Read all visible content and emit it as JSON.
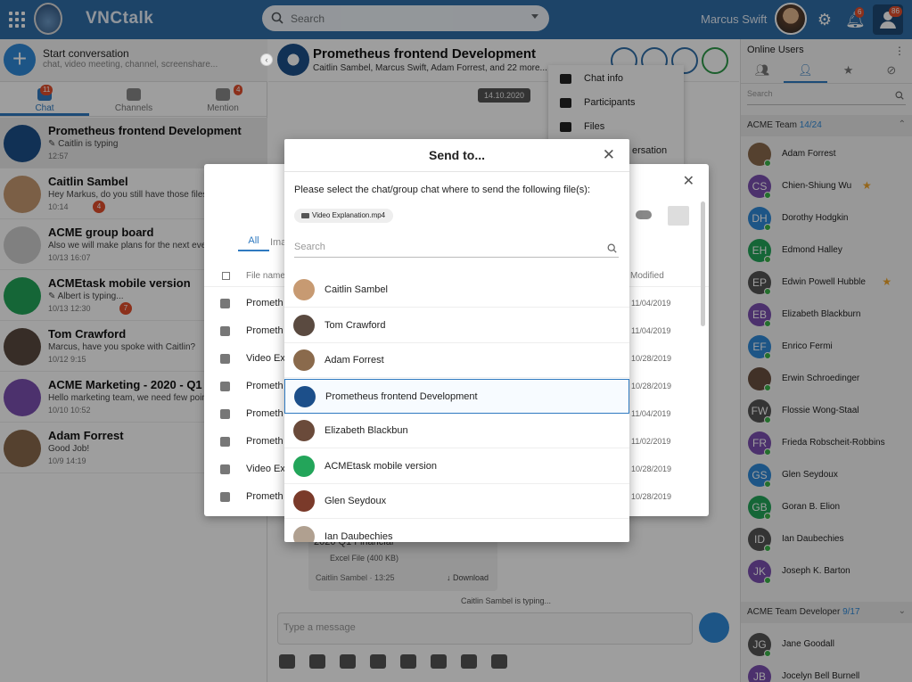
{
  "topbar": {
    "app_name": "VNCtalk",
    "search_placeholder": "Search",
    "user_name": "Marcus Swift",
    "notif_count": "6",
    "profile_count": "86"
  },
  "left": {
    "start_title": "Start conversation",
    "start_sub": "chat, video meeting, channel, screenshare...",
    "tabs": [
      {
        "label": "Chat",
        "badge": "11"
      },
      {
        "label": "Channels",
        "badge": ""
      },
      {
        "label": "Mention",
        "badge": "4"
      }
    ],
    "conversations": [
      {
        "name": "Prometheus frontend Development",
        "preview": "✎ Caitlin is typing",
        "time": "12:57",
        "count": "",
        "avatar": "#1c4f8a"
      },
      {
        "name": "Caitlin Sambel",
        "preview": "Hey Markus, do you still have those files",
        "time": "10:14",
        "count": "4",
        "avatar": "#c79a72"
      },
      {
        "name": "ACME group board",
        "preview": "Also we will make plans for the next ever",
        "time": "10/13 16:07",
        "count": "",
        "avatar": "#cfcfcf"
      },
      {
        "name": "ACMEtask mobile version",
        "preview": "✎ Albert is typing...",
        "time": "10/13 12:30",
        "count": "7",
        "avatar": "#23a55a"
      },
      {
        "name": "Tom Crawford",
        "preview": "Marcus, have you spoke with Caitlin?",
        "time": "10/12 9:15",
        "count": "",
        "avatar": "#5a4a40"
      },
      {
        "name": "ACME Marketing - 2020 - Q1 st",
        "preview": "Hello marketing team, we need few poin",
        "time": "10/10 10:52",
        "count": "",
        "avatar": "#7b4fb0"
      },
      {
        "name": "Adam Forrest",
        "preview": "Good Job!",
        "time": "10/9 14:19",
        "count": "",
        "avatar": "#8a6a4c"
      }
    ]
  },
  "chat": {
    "title": "Prometheus frontend Development",
    "members": "Caitlin Sambel, Marcus Swift, Adam Forrest, and 22 more...",
    "date": "14.10.2020",
    "menu": [
      "Chat info",
      "Participants",
      "Files",
      "ersation"
    ],
    "msg_title": "2020 Q1 Financial",
    "msg_file": "Excel File (400 KB)",
    "msg_meta": "Caitlin Sambel · 13:25",
    "msg_download": "↓ Download",
    "typing": "Caitlin Sambel is typing...",
    "composer_placeholder": "Type a message"
  },
  "right": {
    "title": "Online Users",
    "search_placeholder": "Search",
    "group1": {
      "name": "ACME Team",
      "count": "14/24"
    },
    "users1": [
      {
        "name": "Adam Forrest",
        "initials": "",
        "color": "#8a6a4c",
        "star": false
      },
      {
        "name": "Chien-Shiung Wu",
        "initials": "CS",
        "color": "#7b4fb0",
        "star": true
      },
      {
        "name": "Dorothy Hodgkin",
        "initials": "DH",
        "color": "#2f8ad8",
        "star": false
      },
      {
        "name": "Edmond Halley",
        "initials": "EH",
        "color": "#23a55a",
        "star": false
      },
      {
        "name": "Edwin Powell Hubble",
        "initials": "EP",
        "color": "#555555",
        "star": true
      },
      {
        "name": "Elizabeth Blackburn",
        "initials": "EB",
        "color": "#7b4fb0",
        "star": false
      },
      {
        "name": "Enrico Fermi",
        "initials": "EF",
        "color": "#2f8ad8",
        "star": false
      },
      {
        "name": "Erwin Schroedinger",
        "initials": "",
        "color": "#6a5040",
        "star": false
      },
      {
        "name": "Flossie Wong-Staal",
        "initials": "FW",
        "color": "#555555",
        "star": false
      },
      {
        "name": "Frieda Robscheit-Robbins",
        "initials": "FR",
        "color": "#7b4fb0",
        "star": false
      },
      {
        "name": "Glen Seydoux",
        "initials": "GS",
        "color": "#2f8ad8",
        "star": false
      },
      {
        "name": "Goran B. Elion",
        "initials": "GB",
        "color": "#23a55a",
        "star": false
      },
      {
        "name": "Ian Daubechies",
        "initials": "ID",
        "color": "#555555",
        "star": false
      },
      {
        "name": "Joseph K. Barton",
        "initials": "JK",
        "color": "#7b4fb0",
        "star": false
      }
    ],
    "group2": {
      "name": "ACME Team Developer",
      "count": "9/17"
    },
    "users2": [
      {
        "name": "Jane Goodall",
        "initials": "JG",
        "color": "#555555",
        "star": false
      },
      {
        "name": "Jocelyn Bell Burnell",
        "initials": "JB",
        "color": "#7b4fb0",
        "star": false
      }
    ]
  },
  "files_dialog": {
    "tab_all": "All",
    "tab_images": "Ima",
    "col_name": "File name",
    "col_modified": "Modified",
    "rows": [
      {
        "name": "Prometh",
        "date": "11/04/2019"
      },
      {
        "name": "Prometh",
        "date": "11/04/2019"
      },
      {
        "name": "Video Ex",
        "date": "10/28/2019"
      },
      {
        "name": "Prometh",
        "date": "10/28/2019"
      },
      {
        "name": "Prometh",
        "date": "11/04/2019"
      },
      {
        "name": "Prometh",
        "date": "11/02/2019"
      },
      {
        "name": "Video Ex",
        "date": "10/28/2019"
      },
      {
        "name": "Prometh",
        "date": "10/28/2019"
      }
    ]
  },
  "modal": {
    "title": "Send to...",
    "instruction": "Please select the chat/group chat where to send the following file(s):",
    "file_chip": "Video Explanation.mp4",
    "search_placeholder": "Search",
    "items": [
      {
        "name": "Caitlin Sambel",
        "color": "#c79a72",
        "selected": false
      },
      {
        "name": "Tom Crawford",
        "color": "#5a4a40",
        "selected": false
      },
      {
        "name": "Adam Forrest",
        "color": "#8a6a4c",
        "selected": false
      },
      {
        "name": "Prometheus frontend Development",
        "color": "#1c4f8a",
        "selected": true
      },
      {
        "name": "Elizabeth Blackbun",
        "color": "#6a4a3a",
        "selected": false
      },
      {
        "name": "ACMEtask mobile version",
        "color": "#23a55a",
        "selected": false
      },
      {
        "name": "Glen Seydoux",
        "color": "#7a3a2a",
        "selected": false
      },
      {
        "name": "Ian Daubechies",
        "color": "#b0a090",
        "selected": false
      }
    ]
  }
}
